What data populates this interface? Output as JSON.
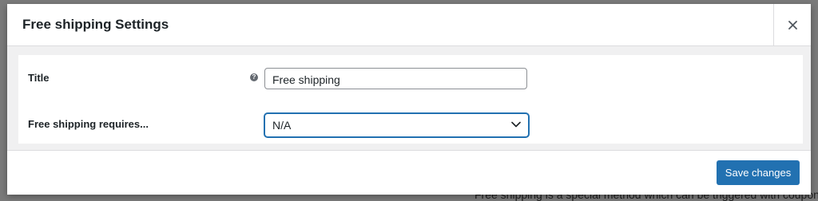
{
  "modal": {
    "title": "Free shipping Settings",
    "close_icon": "close-icon"
  },
  "form": {
    "title_row": {
      "label": "Title",
      "help_icon": "question-mark-icon",
      "help_glyph": "?",
      "value": "Free shipping"
    },
    "requires_row": {
      "label": "Free shipping requires...",
      "selected": "N/A",
      "dropdown_icon": "chevron-down-icon"
    }
  },
  "footer": {
    "save_label": "Save changes"
  },
  "backdrop": {
    "text": "Free shipping is a special method which can be triggered with coupons"
  },
  "colors": {
    "accent": "#2271b1",
    "overlay": "#7a7a7a",
    "body_bg": "#f0f0f1"
  }
}
